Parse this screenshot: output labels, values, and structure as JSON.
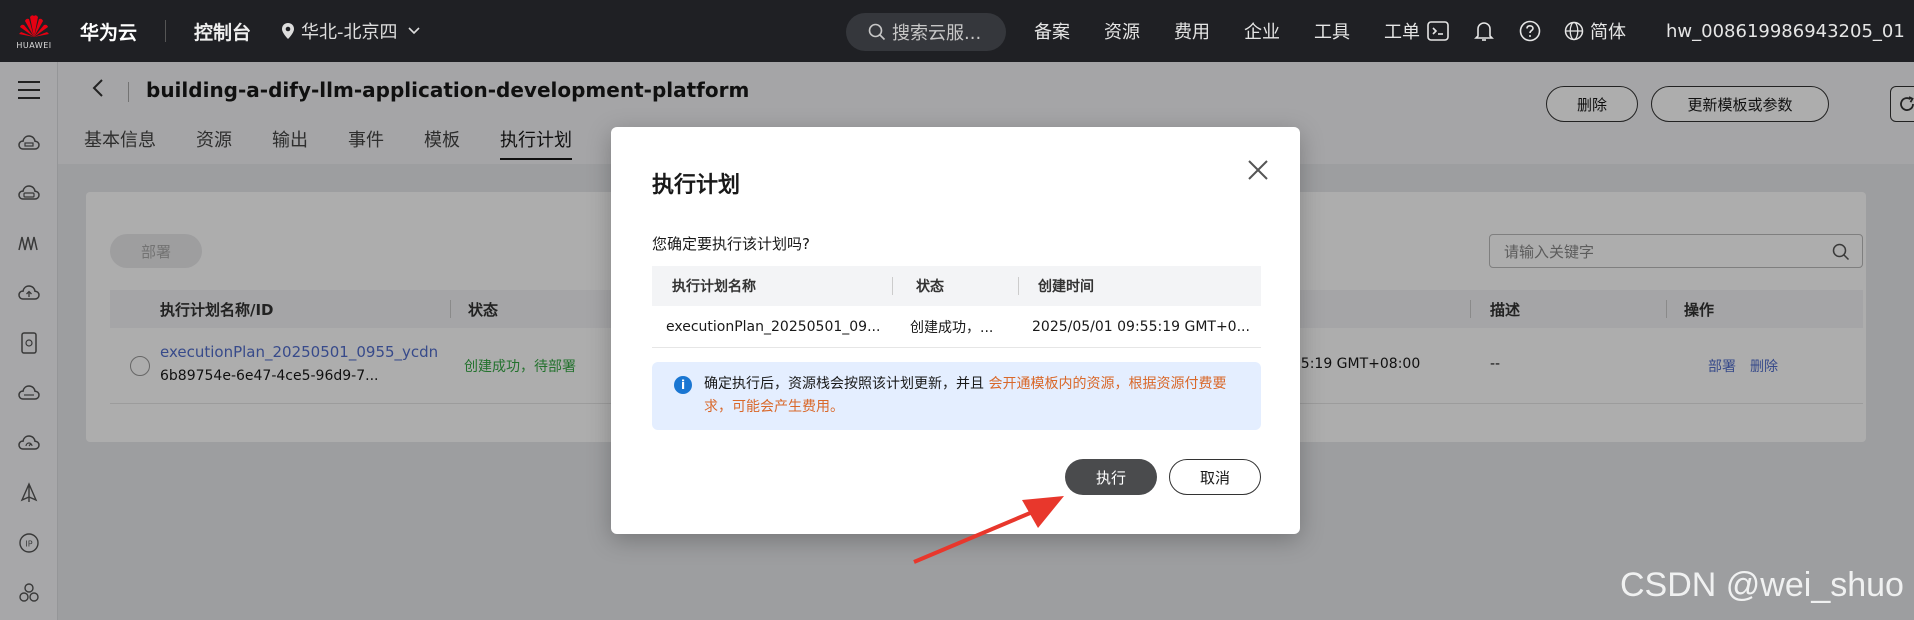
{
  "topbar": {
    "logo_text": "HUAWEI",
    "brand": "华为云",
    "console": "控制台",
    "region": "华北-北京四",
    "search_placeholder": "搜索云服...",
    "nav": [
      "备案",
      "资源",
      "费用",
      "企业",
      "工具",
      "工单"
    ],
    "language": "简体",
    "username": "hw_008619986943205_01"
  },
  "page": {
    "title": "building-a-dify-llm-application-development-platform",
    "tabs": [
      "基本信息",
      "资源",
      "输出",
      "事件",
      "模板",
      "执行计划"
    ],
    "active_tab": "执行计划",
    "delete_label": "删除",
    "update_label": "更新模板或参数"
  },
  "content": {
    "deploy_label": "部署",
    "keyword_placeholder": "请输入关键字",
    "columns": {
      "name": "执行计划名称/ID",
      "status": "状态",
      "desc": "描述",
      "ops": "操作"
    },
    "row": {
      "name": "executionPlan_20250501_0955_ycdn",
      "id": "6b89754e-6e47-4ce5-96d9-7...",
      "status": "创建成功，待部署",
      "created_partial": "1 09:55:19 GMT+08:00",
      "desc": "--",
      "op_deploy": "部署",
      "op_delete": "删除"
    }
  },
  "modal": {
    "title": "执行计划",
    "question": "您确定要执行该计划吗?",
    "columns": {
      "name": "执行计划名称",
      "status": "状态",
      "created": "创建时间"
    },
    "row": {
      "name": "executionPlan_20250501_09...",
      "status": "创建成功，...",
      "created": "2025/05/01 09:55:19 GMT+0..."
    },
    "info": {
      "text_normal": "确定执行后，资源栈会按照该计划更新，并且 ",
      "text_warn": "会开通模板内的资源，根据资源付费要求，可能会产生费用。"
    },
    "execute_label": "执行",
    "cancel_label": "取消"
  },
  "watermark": "CSDN @wei_shuo",
  "colors": {
    "topbar": "#1f2024",
    "link": "#526ecc",
    "success": "#35a845",
    "warning": "#d9682a",
    "info_bg": "#e4eeff",
    "arrow": "#e8372c"
  }
}
